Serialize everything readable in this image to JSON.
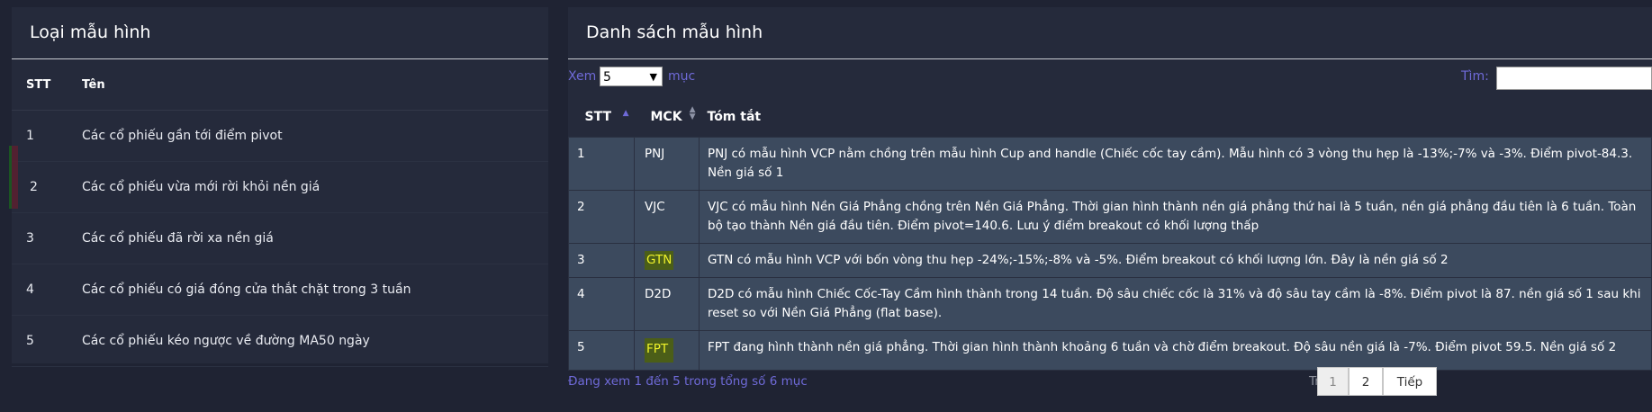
{
  "left": {
    "title": "Loại mẫu hình",
    "headers": [
      "STT",
      "Tên"
    ],
    "rows": [
      {
        "stt": "1",
        "name": "Các cổ phiếu gần tới điểm pivot"
      },
      {
        "stt": "2",
        "name": "Các cổ phiếu vừa mới rời khỏi nền giá"
      },
      {
        "stt": "3",
        "name": "Các cổ phiếu đã rời xa nền giá"
      },
      {
        "stt": "4",
        "name": "Các cổ phiếu có giá đóng cửa thắt chặt trong 3 tuần"
      },
      {
        "stt": "5",
        "name": "Các cổ phiếu kéo ngược về đường MA50 ngày"
      }
    ]
  },
  "right": {
    "title": "Danh sách mẫu hình",
    "length_label_pre": "Xem",
    "length_value": "5",
    "length_label_post": "mục",
    "search_label": "Tìm:",
    "headers": [
      "STT",
      "MCK",
      "Tóm tắt"
    ],
    "rows": [
      {
        "stt": "1",
        "mck": "PNJ",
        "summary": "PNJ có mẫu hình VCP nằm chồng trên mẫu hình Cup and handle (Chiếc cốc tay cầm). Mẫu hình có 3 vòng thu hẹp là -13%;-7% và -3%. Điểm pivot-84.3. Nền giá số 1"
      },
      {
        "stt": "2",
        "mck": "VJC",
        "summary": "VJC có mẫu hình Nền Giá Phẳng chồng trên Nền Giá Phẳng. Thời gian hình thành nền giá phẳng thứ hai là 5 tuần, nền giá phẳng đầu tiên là 6 tuần. Toàn bộ tạo thành Nền giá đầu tiên. Điểm pivot=140.6. Lưu ý điểm breakout có khối lượng thấp"
      },
      {
        "stt": "3",
        "mck": "GTN",
        "summary": "GTN có mẫu hình VCP với bốn vòng thu hẹp -24%;-15%;-8% và -5%. Điểm breakout có khối lượng lớn. Đây là nền giá số 2"
      },
      {
        "stt": "4",
        "mck": "D2D",
        "summary": "D2D có mẫu hình Chiếc Cốc-Tay Cầm hình thành trong 14 tuần. Độ sâu chiếc cốc là 31% và độ sâu tay cầm là -8%. Điểm pivot là 87. nền giá số 1 sau khi reset so với Nền Giá Phẳng (flat base)."
      },
      {
        "stt": "5",
        "mck": "FPT",
        "summary": "FPT đang hình thành nền giá phẳng. Thời gian hình thành khoảng 6 tuần và chờ điểm breakout. Độ sâu nền giá là -7%. Điểm pivot 59.5. Nền giá số 2"
      }
    ],
    "info": "Đang xem 1 đến 5 trong tổng số 6 mục",
    "pager": {
      "prev": "Trước",
      "pages": [
        "1",
        "2"
      ],
      "next": "Tiếp"
    }
  }
}
